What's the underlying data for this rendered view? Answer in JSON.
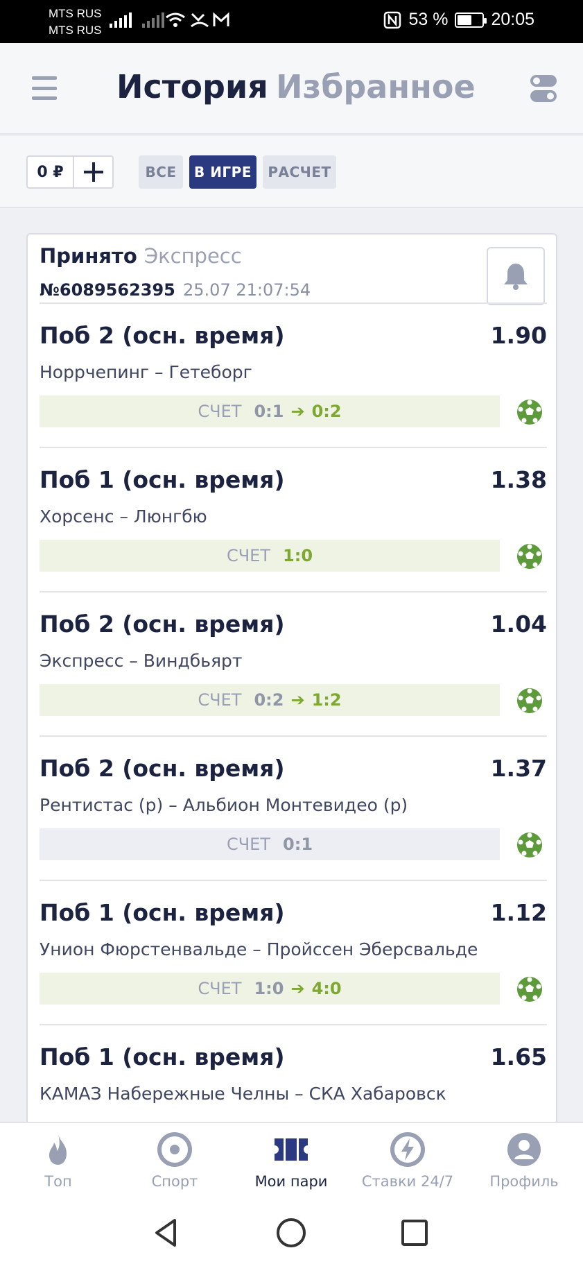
{
  "status_bar": {
    "carrier1": "MTS RUS",
    "carrier2": "MTS RUS",
    "battery": "53 %",
    "battery_level": 0.53,
    "time": "20:05"
  },
  "header": {
    "tab_history": "История",
    "tab_favorites": "Избранное",
    "menu_icon": "hamburger-icon",
    "settings_icon": "toggle-settings-icon"
  },
  "filters": {
    "balance": "0 ₽",
    "add_icon": "plus-icon",
    "chips": [
      {
        "label": "ВСЕ",
        "active": false
      },
      {
        "label": "В ИГРЕ",
        "active": true
      },
      {
        "label": "РАСЧЕТ",
        "active": false
      }
    ]
  },
  "bet": {
    "status": "Принято",
    "type": "Экспресс",
    "number": "№6089562395",
    "datetime": "25.07 21:07:54",
    "bell_icon": "bell-icon",
    "events": [
      {
        "outcome": "Поб 2 (осн. время)",
        "odds": "1.90",
        "teams": "Норрчепинг – Гетеборг",
        "score_label": "СЧЕТ",
        "score_old": "0:1",
        "score_new": "0:2",
        "live": true
      },
      {
        "outcome": "Поб 1 (осн. время)",
        "odds": "1.38",
        "teams": "Хорсенс – Люнгбю",
        "score_label": "СЧЕТ",
        "score_old": "",
        "score_new": "1:0",
        "live": true
      },
      {
        "outcome": "Поб 2 (осн. время)",
        "odds": "1.04",
        "teams": "Экспресс – Виндбьярт",
        "score_label": "СЧЕТ",
        "score_old": "0:2",
        "score_new": "1:2",
        "live": true
      },
      {
        "outcome": "Поб 2 (осн. время)",
        "odds": "1.37",
        "teams": "Рентистас (р) – Альбион Монтевидео (р)",
        "score_label": "СЧЕТ",
        "score_old": "",
        "score_new": "0:1",
        "live": false
      },
      {
        "outcome": "Поб 1 (осн. время)",
        "odds": "1.12",
        "teams": "Унион Фюрстенвальде – Пройссен Эберсвальде",
        "score_label": "СЧЕТ",
        "score_old": "1:0",
        "score_new": "4:0",
        "live": true
      },
      {
        "outcome": "Поб 1 (осн. время)",
        "odds": "1.65",
        "teams": "КАМАЗ Набережные Челны – СКА Хабаровск",
        "score_label": "",
        "score_old": "",
        "score_new": "",
        "live": false
      }
    ]
  },
  "bottom_nav": [
    {
      "label": "Топ",
      "icon": "flame-icon",
      "active": false
    },
    {
      "label": "Спорт",
      "icon": "target-icon",
      "active": false
    },
    {
      "label": "Мои пари",
      "icon": "ticket-icon",
      "active": true
    },
    {
      "label": "Ставки 24/7",
      "icon": "lightning-icon",
      "active": false
    },
    {
      "label": "Профиль",
      "icon": "profile-icon",
      "active": false
    }
  ],
  "system_nav": [
    "back-icon",
    "home-icon",
    "recents-icon"
  ],
  "colors": {
    "primary": "#2b3a80",
    "text_dark": "#1c2340",
    "muted": "#9aa0b4",
    "score_green": "#7ea832",
    "ball_green": "#5c9a3a"
  }
}
